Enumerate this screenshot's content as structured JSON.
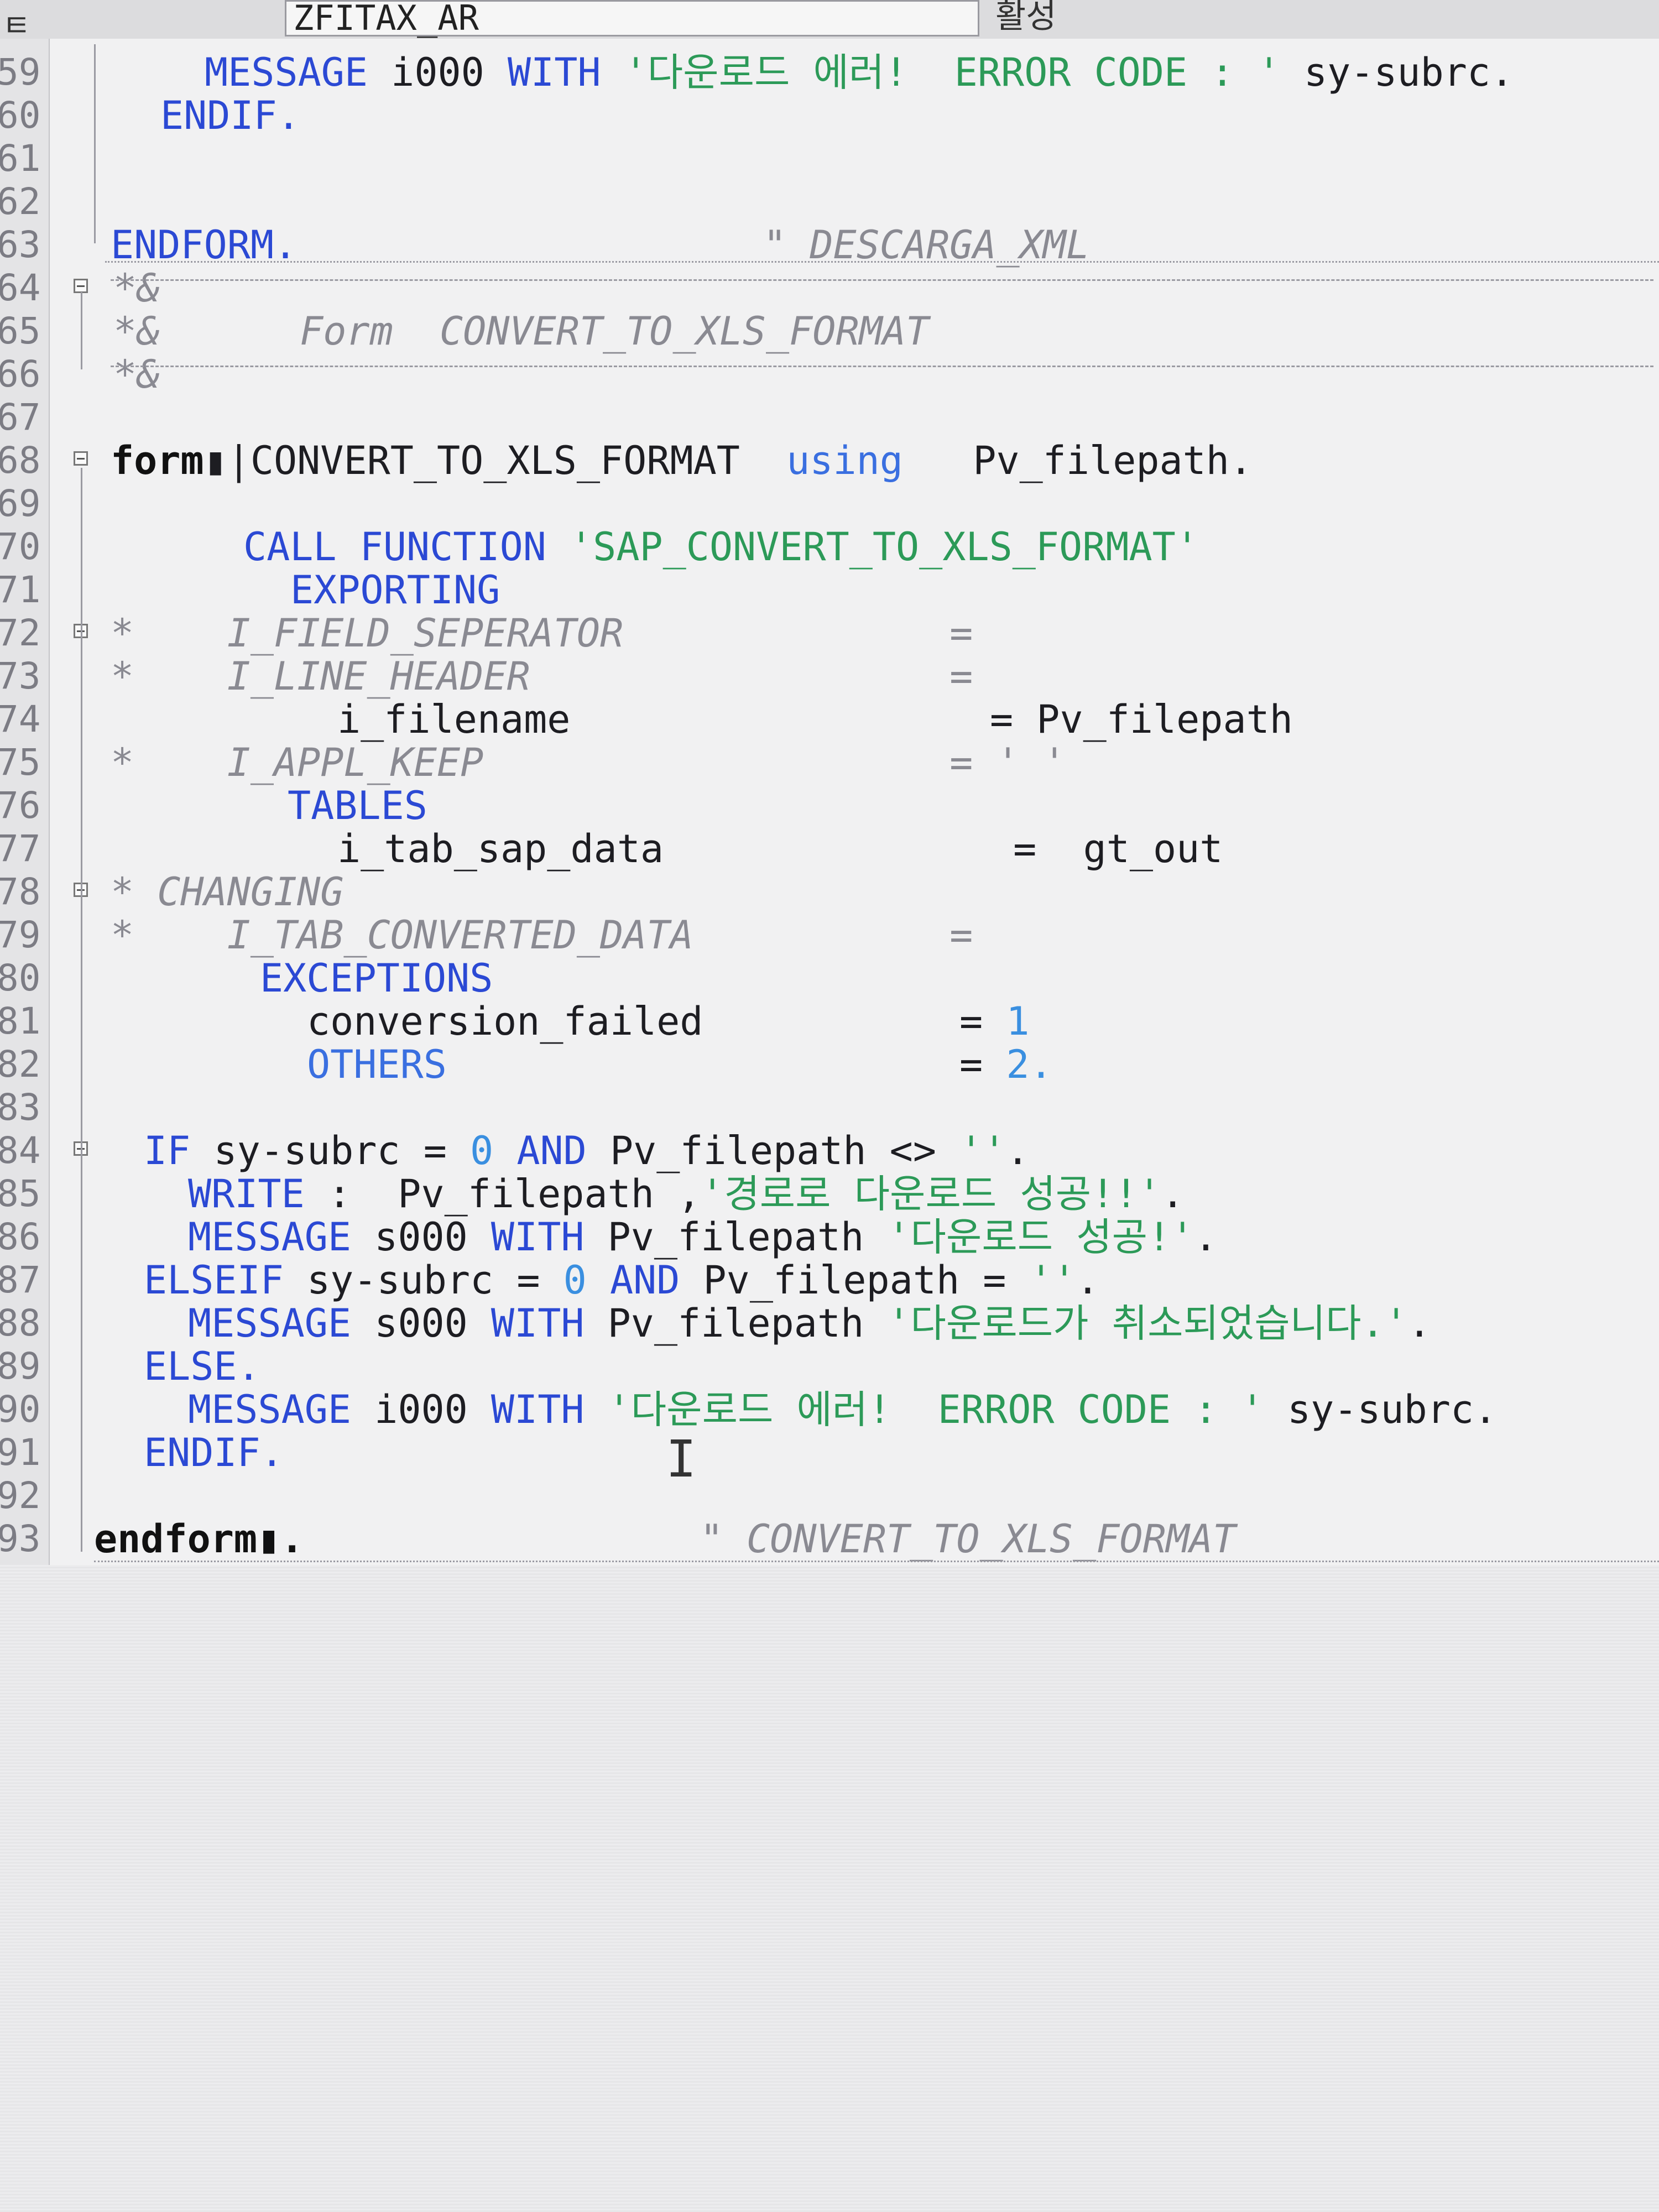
{
  "window": {
    "corner_glyph": "ㅌ",
    "program_name": "ZFITAX_AR",
    "status": "활성"
  },
  "colors": {
    "keyword": "#2b49d4",
    "string": "#2c9a58",
    "comment": "#8a8a92",
    "number": "#3a8fe0",
    "background": "#f1f1f2"
  },
  "code_lines": [
    {
      "ln": "59",
      "text": "      MESSAGE i000 WITH '다운로드 에러!  ERROR CODE : ' sy-subrc."
    },
    {
      "ln": "60",
      "text": "    ENDIF."
    },
    {
      "ln": "61",
      "text": ""
    },
    {
      "ln": "62",
      "text": ""
    },
    {
      "ln": "63",
      "text": "ENDFORM.                    \" DESCARGA_XML"
    },
    {
      "ln": "64",
      "text": "*&---------------------------------------------------------------------*"
    },
    {
      "ln": "65",
      "text": "*&      Form  CONVERT_TO_XLS_FORMAT"
    },
    {
      "ln": "66",
      "text": "*&---------------------------------------------------------------------*"
    },
    {
      "ln": "67",
      "text": ""
    },
    {
      "ln": "68",
      "text": "form |CONVERT_TO_XLS_FORMAT  using   Pv_filepath."
    },
    {
      "ln": "69",
      "text": ""
    },
    {
      "ln": "70",
      "text": "CALL FUNCTION 'SAP_CONVERT_TO_XLS_FORMAT'"
    },
    {
      "ln": "71",
      "text": "EXPORTING"
    },
    {
      "ln": "72",
      "text": "I_FIELD_SEPERATOR              ="
    },
    {
      "ln": "73",
      "text": "I_LINE_HEADER                  ="
    },
    {
      "ln": "74",
      "text": "i_filename                  = Pv_filepath"
    },
    {
      "ln": "75",
      "text": "I_APPL_KEEP                    = ' '"
    },
    {
      "ln": "76",
      "text": "TABLES"
    },
    {
      "ln": "77",
      "text": "i_tab_sap_data               =  gt_out"
    },
    {
      "ln": "78",
      "text": "CHANGING"
    },
    {
      "ln": "79",
      "text": "I_TAB_CONVERTED_DATA           ="
    },
    {
      "ln": "80",
      "text": "EXCEPTIONS"
    },
    {
      "ln": "81",
      "text": "conversion_failed           = 1"
    },
    {
      "ln": "82",
      "text": "OTHERS                      = 2."
    },
    {
      "ln": "83",
      "text": ""
    },
    {
      "ln": "84",
      "text": "IF sy-subrc = 0 AND Pv_filepath <> ''."
    },
    {
      "ln": "85",
      "text": "WRITE :  Pv_filepath ,'경로로 다운로드 성공!!'."
    },
    {
      "ln": "86",
      "text": "MESSAGE s000 WITH Pv_filepath '다운로드 성공!'."
    },
    {
      "ln": "87",
      "text": "ELSEIF sy-subrc = 0 AND Pv_filepath = ''."
    },
    {
      "ln": "88",
      "text": "MESSAGE s000 WITH Pv_filepath '다운로드가 취소되었습니다.'."
    },
    {
      "ln": "89",
      "text": "ELSE."
    },
    {
      "ln": "90",
      "text": "MESSAGE i000 WITH '다운로드 에러!  ERROR CODE : ' sy-subrc."
    },
    {
      "ln": "91",
      "text": "ENDIF."
    },
    {
      "ln": "92",
      "text": ""
    },
    {
      "ln": "93",
      "text": "endform.                 \" CONVERT_TO_XLS_FORMAT"
    }
  ]
}
